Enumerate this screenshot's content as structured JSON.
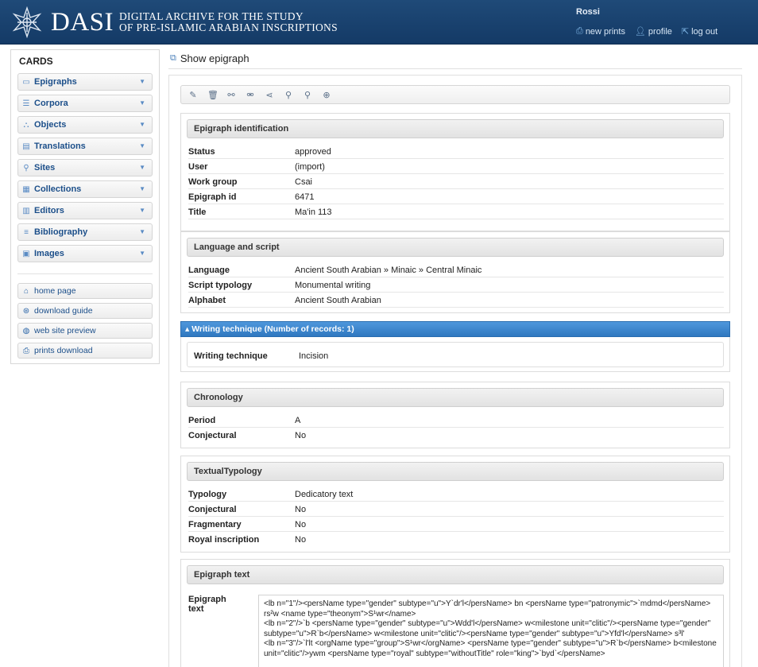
{
  "header": {
    "logo_title": "DASI",
    "logo_subtitle_line1": "DIGITAL ARCHIVE FOR THE STUDY",
    "logo_subtitle_line2": "OF PRE-ISLAMIC ARABIAN INSCRIPTIONS",
    "user": "Rossi",
    "links": [
      {
        "label": "new prints",
        "icon": "printer-icon"
      },
      {
        "label": "profile",
        "icon": "user-icon"
      },
      {
        "label": "log out",
        "icon": "logout-icon"
      }
    ]
  },
  "sidebar": {
    "title": "CARDS",
    "items": [
      {
        "label": "Epigraphs",
        "icon": "epigraph-icon"
      },
      {
        "label": "Corpora",
        "icon": "list-icon"
      },
      {
        "label": "Objects",
        "icon": "object-icon"
      },
      {
        "label": "Translations",
        "icon": "document-icon"
      },
      {
        "label": "Sites",
        "icon": "map-pin-icon"
      },
      {
        "label": "Collections",
        "icon": "collection-icon"
      },
      {
        "label": "Editors",
        "icon": "editors-icon"
      },
      {
        "label": "Bibliography",
        "icon": "bibliography-icon"
      },
      {
        "label": "Images",
        "icon": "image-icon"
      }
    ],
    "links": [
      {
        "label": "home page",
        "icon": "home-icon"
      },
      {
        "label": "download guide",
        "icon": "help-icon"
      },
      {
        "label": "web site preview",
        "icon": "globe-icon"
      },
      {
        "label": "prints download",
        "icon": "printer-icon"
      }
    ]
  },
  "page": {
    "title": "Show epigraph"
  },
  "toolbar": {
    "icons": [
      "edit-icon",
      "delete-icon",
      "link-icon",
      "unlink-icon",
      "share-icon",
      "zoom-in-icon",
      "zoom-out-icon",
      "globe-icon"
    ]
  },
  "sections": {
    "identification": {
      "heading": "Epigraph identification",
      "rows": [
        {
          "key": "Status",
          "value": "approved"
        },
        {
          "key": "User",
          "value": "(import)"
        },
        {
          "key": "Work group",
          "value": "Csai"
        },
        {
          "key": "Epigraph id",
          "value": "6471"
        },
        {
          "key": "Title",
          "value": "Ma'in 113"
        }
      ]
    },
    "language": {
      "heading": "Language and script",
      "rows": [
        {
          "key": "Language",
          "value": "Ancient South Arabian » Minaic » Central Minaic"
        },
        {
          "key": "Script typology",
          "value": "Monumental writing"
        },
        {
          "key": "Alphabet",
          "value": "Ancient South Arabian"
        }
      ]
    },
    "writing_technique": {
      "bar_label": "▴ Writing technique (Number of records: 1)",
      "key": "Writing technique",
      "value": "Incision"
    },
    "chronology": {
      "heading": "Chronology",
      "rows": [
        {
          "key": "Period",
          "value": "A"
        },
        {
          "key": "Conjectural",
          "value": "No"
        }
      ]
    },
    "typology": {
      "heading": "TextualTypology",
      "rows": [
        {
          "key": "Typology",
          "value": "Dedicatory text"
        },
        {
          "key": "Conjectural",
          "value": "No"
        },
        {
          "key": "Fragmentary",
          "value": "No"
        },
        {
          "key": "Royal inscription",
          "value": "No"
        }
      ]
    },
    "text": {
      "heading": "Epigraph text",
      "label": "Epigraph text",
      "content": "<lb n=\"1\"/><persName type=\"gender\" subtype=\"u\">Y`dr'l</persName> bn <persName type=\"patronymic\">`mdmd</persName> rs²w <name type=\"theonym\">S¹wr</name>\n<lb n=\"2\"/>`b <persName type=\"gender\" subtype=\"u\">Wdd'l</persName> w<milestone unit=\"clitic\"/><persName type=\"gender\" subtype=\"u\">R`b</persName> w<milestone unit=\"clitic\"/><persName type=\"gender\" subtype=\"u\">Yfd'l</persName> s³l'\n<lb n=\"3\"/>`l'lt <orgName type=\"group\">S¹wr</orgName> <persName type=\"gender\" subtype=\"u\">R`b</persName> b<milestone unit=\"clitic\"/>ywm <persName type=\"royal\" subtype=\"withoutTitle\" role=\"king\">`byd`</persName>"
    }
  }
}
